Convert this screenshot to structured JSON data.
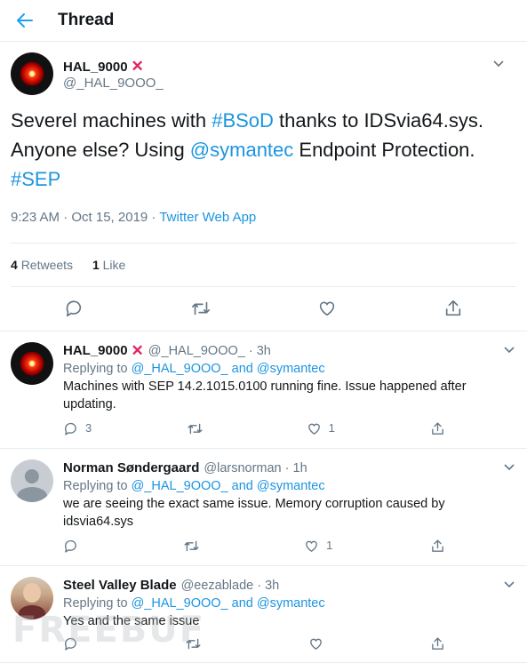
{
  "header": {
    "title": "Thread"
  },
  "main_tweet": {
    "name": "HAL_9000",
    "name_emoji": "✕",
    "handle": "@_HAL_9OOO_",
    "text_parts": [
      {
        "t": "Severel machines with ",
        "link": false
      },
      {
        "t": "#BSoD",
        "link": true
      },
      {
        "t": " thanks to IDSvia64.sys. Anyone else? Using ",
        "link": false
      },
      {
        "t": "@symantec",
        "link": true
      },
      {
        "t": " Endpoint Protection. ",
        "link": false
      },
      {
        "t": "#SEP",
        "link": true
      }
    ],
    "time": "9:23 AM · Oct 15, 2019 · ",
    "source": "Twitter Web App",
    "retweets_count": "4",
    "retweets_label": "Retweets",
    "likes_count": "1",
    "likes_label": "Like"
  },
  "replies": [
    {
      "name": "HAL_9000",
      "has_x": true,
      "handle": "@_HAL_9OOO_ · 3h",
      "replying_prefix": "Replying to ",
      "replying_to": "@_HAL_9OOO_ and @symantec",
      "text": "Machines with SEP 14.2.1015.0100 running fine. Issue happened after updating.",
      "reply_count": "3",
      "retweet_count": "",
      "like_count": "1",
      "avatar": "hal"
    },
    {
      "name": "Norman Søndergaard",
      "has_x": false,
      "handle": "@larsnorman · 1h",
      "replying_prefix": "Replying to ",
      "replying_to": "@_HAL_9OOO_ and @symantec",
      "text": "we are seeing the exact same issue. Memory corruption caused by idsvia64.sys",
      "reply_count": "",
      "retweet_count": "",
      "like_count": "1",
      "avatar": "person"
    },
    {
      "name": "Steel Valley Blade",
      "has_x": false,
      "handle": "@eezablade · 3h",
      "replying_prefix": "Replying to ",
      "replying_to": "@_HAL_9OOO_ and @symantec",
      "text": "Yes and the same issue",
      "reply_count": "",
      "retweet_count": "",
      "like_count": "",
      "avatar": "steel"
    }
  ],
  "watermark": "FREEBUF",
  "icons": {
    "back": "arrow-left-icon",
    "chevron": "chevron-down-icon",
    "reply": "comment-icon",
    "retweet": "retweet-icon",
    "like": "heart-icon",
    "share": "share-icon"
  },
  "colors": {
    "accent": "#1da1f2",
    "link": "#1b95e0",
    "muted": "#657786",
    "x_mark": "#e0245e"
  }
}
